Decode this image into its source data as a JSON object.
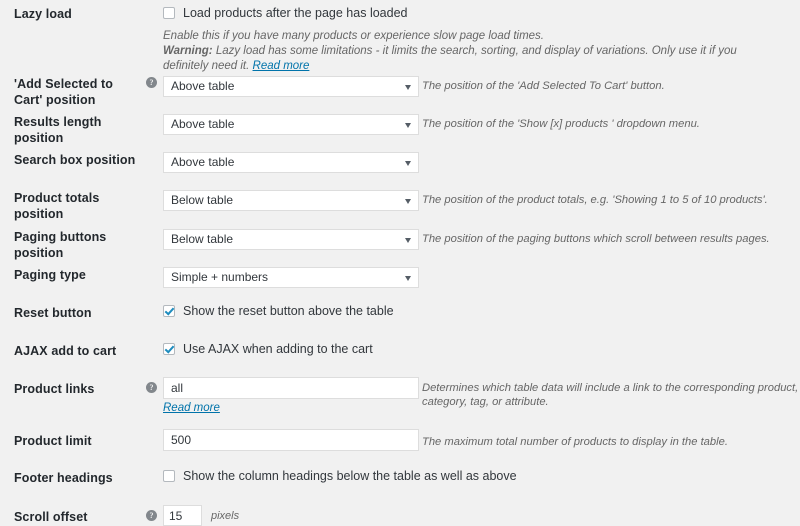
{
  "theme": {
    "background": "#f1f1f1",
    "label_color": "#23282d",
    "description_color": "#666666",
    "link_color": "#0073aa",
    "input_border": "#dddddd",
    "checkbox_accent": "#1e8cbe"
  },
  "settings": {
    "lazy_load": {
      "label": "Lazy load",
      "checkbox_label": "Load products after the page has loaded",
      "checked": false,
      "description_line1": "Enable this if you have many products or experience slow page load times.",
      "warning_prefix": "Warning:",
      "warning_text": " Lazy load has some limitations - it limits the search, sorting, and display of variations. Only use it if you definitely need it. ",
      "read_more": "Read more"
    },
    "add_selected_to_cart_position": {
      "label": "'Add Selected to Cart' position",
      "help_icon": "help-icon",
      "value": "Above table",
      "description": "The position of the 'Add Selected To Cart' button."
    },
    "results_length_position": {
      "label": "Results length position",
      "value": "Above table",
      "description": "The position of the 'Show [x] products ' dropdown menu."
    },
    "search_box_position": {
      "label": "Search box position",
      "value": "Above table",
      "description": ""
    },
    "product_totals_position": {
      "label": "Product totals position",
      "value": "Below table",
      "description": "The position of the product totals, e.g. 'Showing 1 to 5 of 10 products'."
    },
    "paging_buttons_position": {
      "label": "Paging buttons position",
      "value": "Below table",
      "description": "The position of the paging buttons which scroll between results pages."
    },
    "paging_type": {
      "label": "Paging type",
      "value": "Simple + numbers",
      "description": ""
    },
    "reset_button": {
      "label": "Reset button",
      "checkbox_label": "Show the reset button above the table",
      "checked": true
    },
    "ajax_add_to_cart": {
      "label": "AJAX add to cart",
      "checkbox_label": "Use AJAX when adding to the cart",
      "checked": true
    },
    "product_links": {
      "label": "Product links",
      "help_icon": "help-icon",
      "value": "all",
      "description": "Determines which table data will include a link to the corresponding product, category, tag, or attribute.",
      "read_more": "Read more"
    },
    "product_limit": {
      "label": "Product limit",
      "value": "500",
      "description": "The maximum total number of products to display in the table."
    },
    "footer_headings": {
      "label": "Footer headings",
      "checkbox_label": "Show the column headings below the table as well as above",
      "checked": false
    },
    "scroll_offset": {
      "label": "Scroll offset",
      "help_icon": "help-icon",
      "value": "15",
      "unit": "pixels"
    }
  }
}
